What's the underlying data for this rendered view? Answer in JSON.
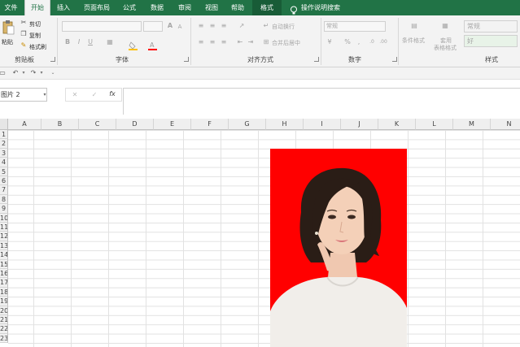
{
  "tabs": [
    "文件",
    "开始",
    "插入",
    "页面布局",
    "公式",
    "数据",
    "审阅",
    "视图",
    "帮助",
    "格式"
  ],
  "tell_me": "操作说明搜索",
  "clipboard": {
    "paste": "粘贴",
    "cut": "剪切",
    "copy": "复制",
    "format_painter": "格式刷",
    "label": "剪贴板"
  },
  "font": {
    "label": "字体",
    "bold": "B",
    "italic": "I",
    "underline": "U",
    "grow": "A",
    "shrink": "A"
  },
  "alignment": {
    "wrap": "自动换行",
    "merge": "合并后居中",
    "label": "对齐方式"
  },
  "number": {
    "format": "常规",
    "percent": "%",
    "comma": ",",
    "label": "数字"
  },
  "styles": {
    "conditional": "条件格式",
    "table_format_1": "套用",
    "table_format_2": "表格格式",
    "normal": "常规",
    "good": "好",
    "label": "样式"
  },
  "name_box": "图片 2",
  "fx": "fx",
  "columns": [
    "A",
    "B",
    "C",
    "D",
    "E",
    "F",
    "G",
    "H",
    "I",
    "J",
    "K",
    "L",
    "M",
    "N"
  ],
  "rows": [
    "1",
    "2",
    "3",
    "4",
    "5",
    "6",
    "7",
    "8",
    "9",
    "10",
    "11",
    "12",
    "13",
    "14",
    "15",
    "16",
    "17",
    "18",
    "19",
    "20",
    "21",
    "22",
    "23"
  ],
  "colors": {
    "excel_green": "#217346",
    "picture_bg": "#ff0000"
  }
}
